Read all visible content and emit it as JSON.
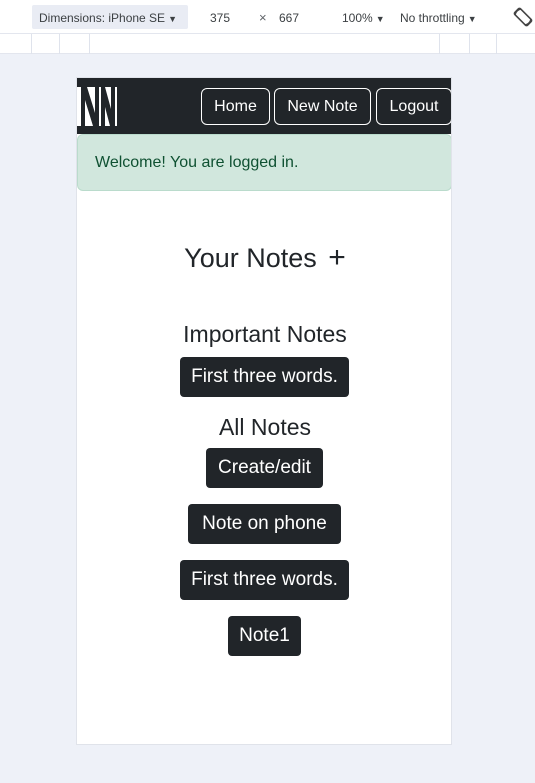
{
  "devtools": {
    "dimensions_label": "Dimensions: iPhone SE",
    "width": "375",
    "times": "×",
    "height": "667",
    "zoom": "100%",
    "throttling": "No throttling",
    "caret": "▼"
  },
  "navbar": {
    "home": "Home",
    "new_note": "New Note",
    "logout": "Logout"
  },
  "alert": {
    "message": "Welcome! You are logged in."
  },
  "main": {
    "title": "Your Notes",
    "add_symbol": "+",
    "important_heading": "Important Notes",
    "important_notes": [
      "First three words."
    ],
    "all_heading": "All Notes",
    "all_notes": [
      "Create/edit",
      "Note on phone",
      "First three words.",
      "Note1"
    ]
  },
  "colors": {
    "navbar_bg": "#212529",
    "alert_bg": "#d1e7dd",
    "alert_text": "#0f5132",
    "note_button_bg": "#212529",
    "page_bg": "#eef1f8"
  }
}
